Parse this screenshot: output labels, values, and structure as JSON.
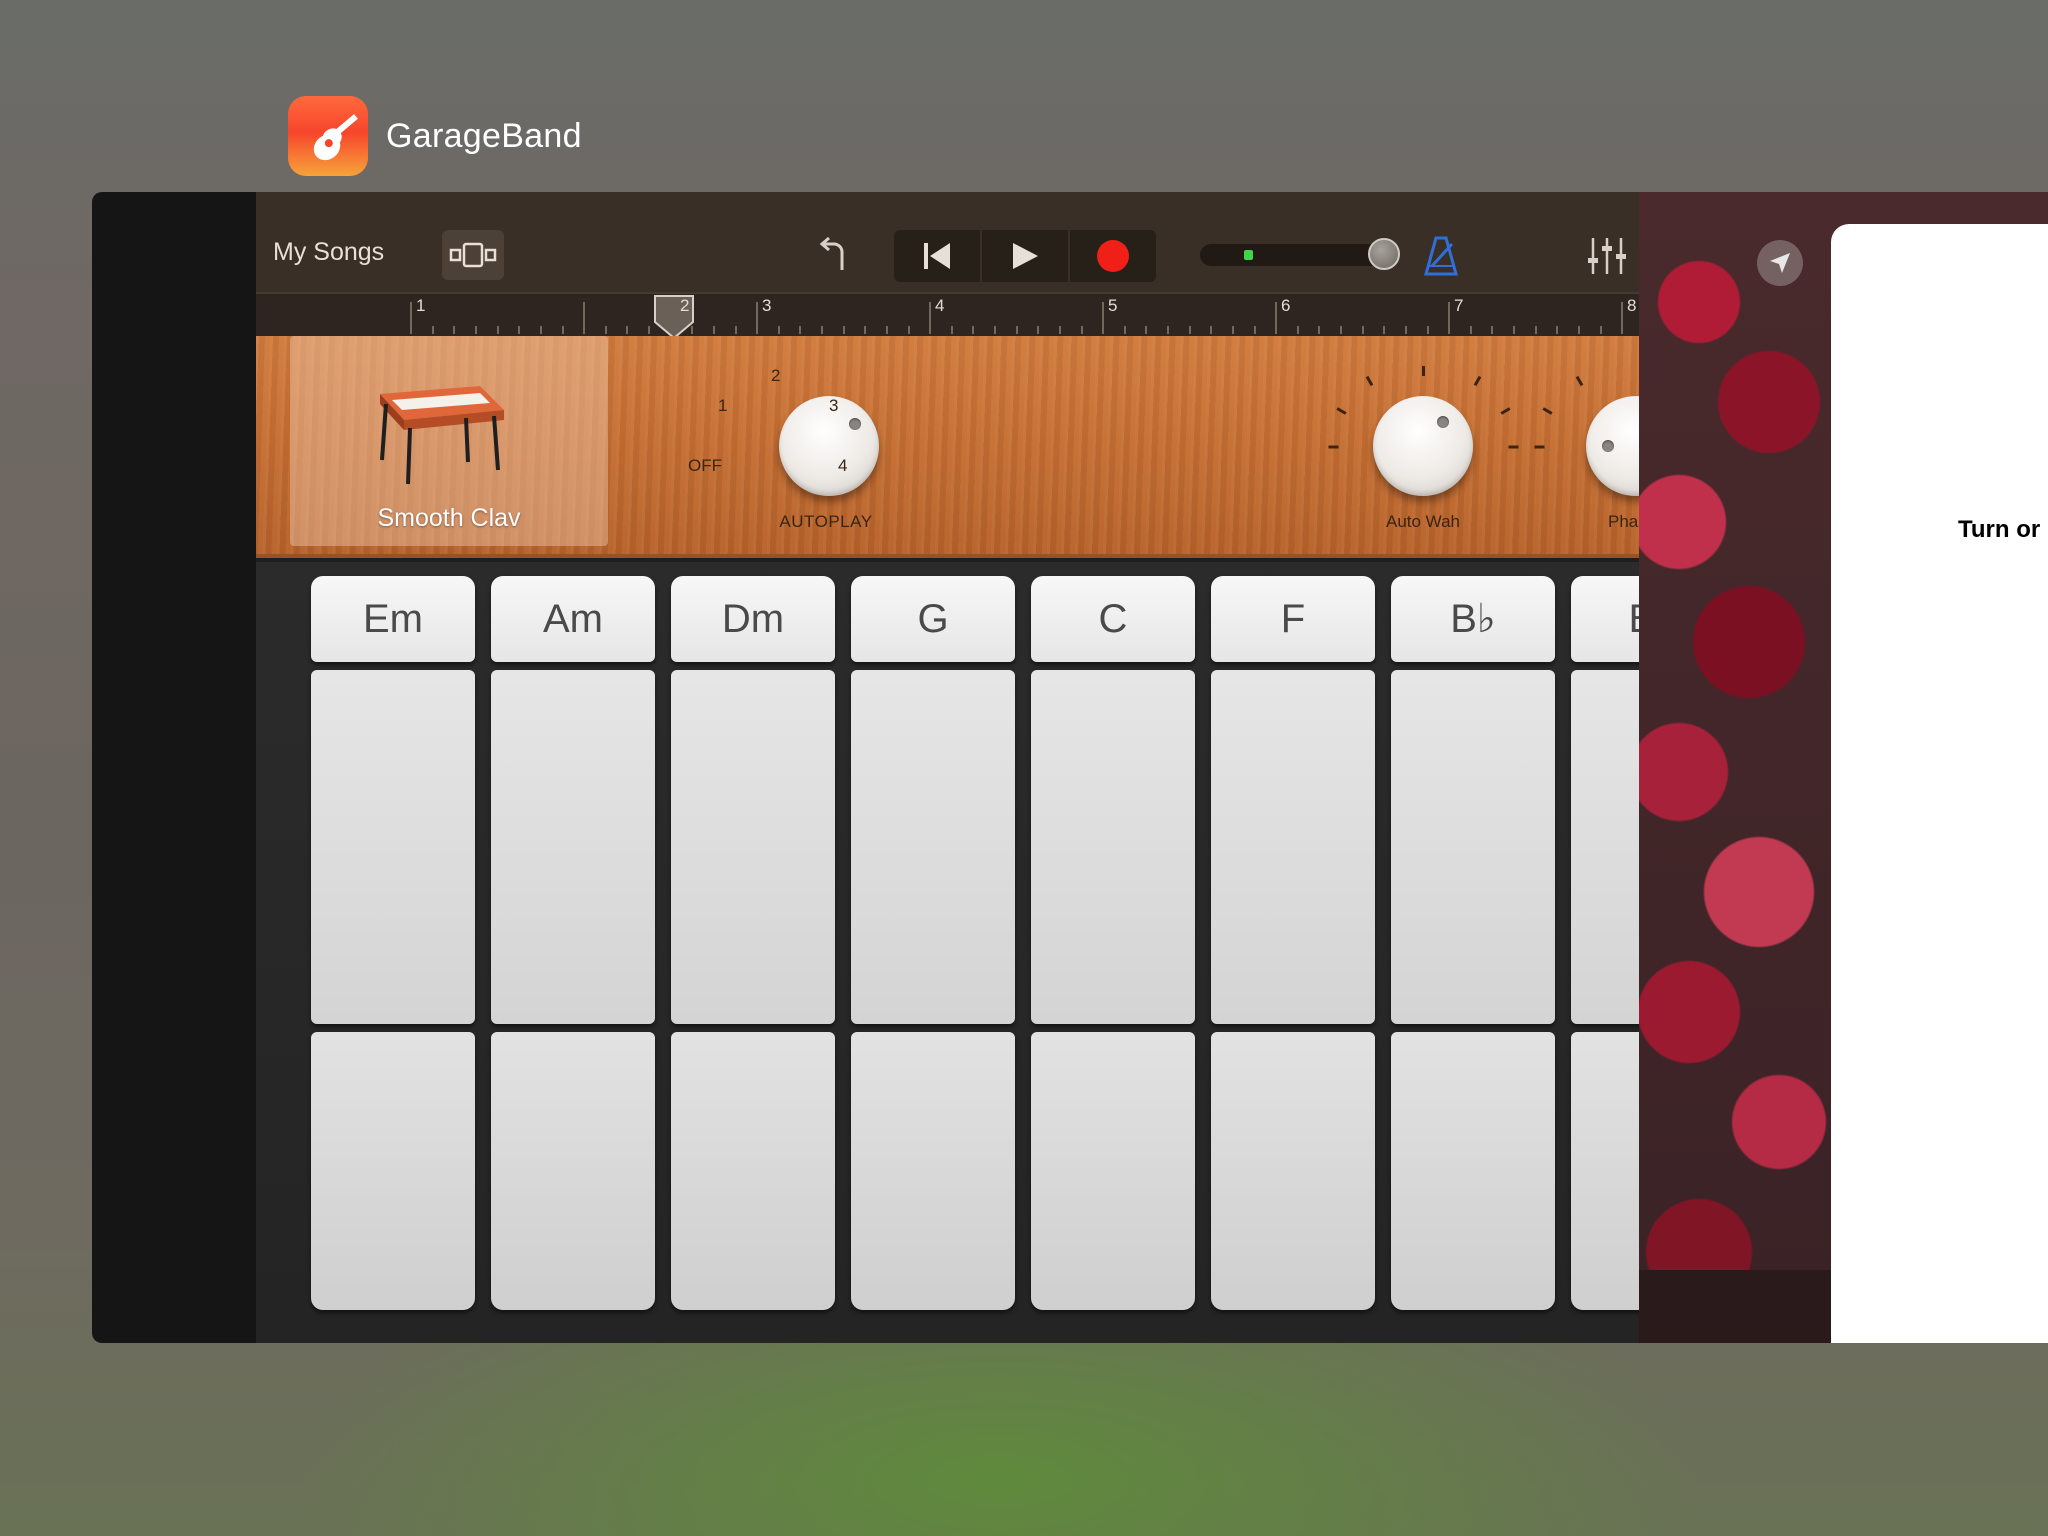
{
  "switcher": {
    "app_name": "GarageBand"
  },
  "toolbar": {
    "my_songs": "My Songs"
  },
  "ruler": {
    "bars": [
      "1",
      "2",
      "3",
      "4",
      "5",
      "6",
      "7",
      "8"
    ]
  },
  "instrument": {
    "name": "Smooth Clav",
    "autoplay": {
      "label": "AUTOPLAY",
      "marks": {
        "off": "OFF",
        "one": "1",
        "two": "2",
        "three": "3",
        "four": "4"
      }
    },
    "auto_wah": {
      "label": "Auto Wah"
    },
    "third_knob": {
      "label": "Pha"
    }
  },
  "chords": [
    "Em",
    "Am",
    "Dm",
    "G",
    "C",
    "F",
    "B♭",
    "Bo"
  ],
  "background_app": {
    "sheet_text": "Turn or"
  },
  "colors": {
    "record": "#f02018",
    "metronome": "#2f6fd6",
    "level": "#3fd54a",
    "wood": "#c66f33"
  }
}
